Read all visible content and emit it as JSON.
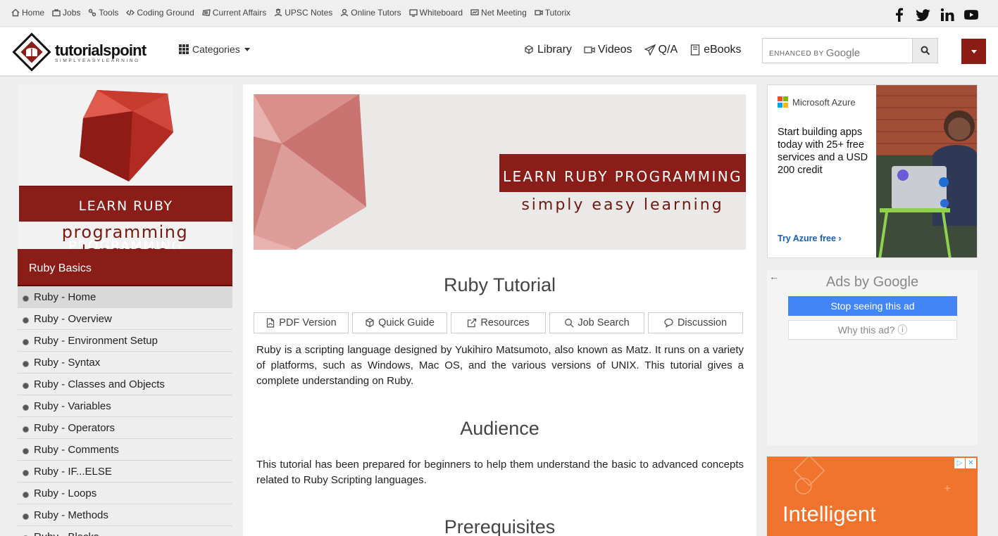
{
  "topbar": {
    "links": [
      {
        "label": "Home",
        "icon": "home-icon"
      },
      {
        "label": "Jobs",
        "icon": "briefcase-icon"
      },
      {
        "label": "Tools",
        "icon": "tools-icon"
      },
      {
        "label": "Coding Ground",
        "icon": "code-icon"
      },
      {
        "label": "Current Affairs",
        "icon": "newspaper-icon"
      },
      {
        "label": "UPSC Notes",
        "icon": "user-graduate-icon"
      },
      {
        "label": "Online Tutors",
        "icon": "user-icon"
      },
      {
        "label": "Whiteboard",
        "icon": "whiteboard-icon"
      },
      {
        "label": "Net Meeting",
        "icon": "meeting-icon"
      },
      {
        "label": "Tutorix",
        "icon": "video-icon"
      }
    ],
    "social": [
      "facebook-icon",
      "twitter-icon",
      "linkedin-icon",
      "youtube-icon"
    ]
  },
  "header": {
    "logo_text": "tutorialspoint",
    "logo_tagline": "SIMPLYEASYLEARNING",
    "categories_label": "Categories",
    "nav": [
      {
        "label": "Library",
        "icon": "library-icon"
      },
      {
        "label": "Videos",
        "icon": "video-icon"
      },
      {
        "label": "Q/A",
        "icon": "paper-plane-icon"
      },
      {
        "label": "eBooks",
        "icon": "book-icon"
      }
    ],
    "search_prefix": "ENHANCED BY",
    "search_brand": "Google"
  },
  "sidebar": {
    "banner_band": "LEARN RUBY PROGRAMMING",
    "banner_sub": "programming language",
    "heading": "Ruby Basics",
    "items": [
      "Ruby - Home",
      "Ruby - Overview",
      "Ruby - Environment Setup",
      "Ruby - Syntax",
      "Ruby - Classes and Objects",
      "Ruby - Variables",
      "Ruby - Operators",
      "Ruby - Comments",
      "Ruby - IF...ELSE",
      "Ruby - Loops",
      "Ruby - Methods",
      "Ruby - Blocks"
    ],
    "active_index": 0
  },
  "main": {
    "hero_band": "LEARN RUBY PROGRAMMING",
    "hero_sub": "simply easy learning",
    "title": "Ruby Tutorial",
    "tabs": [
      {
        "label": "PDF Version",
        "icon": "pdf-icon"
      },
      {
        "label": "Quick Guide",
        "icon": "cube-icon"
      },
      {
        "label": "Resources",
        "icon": "external-link-icon"
      },
      {
        "label": "Job Search",
        "icon": "search-icon"
      },
      {
        "label": "Discussion",
        "icon": "comments-icon"
      }
    ],
    "intro": "Ruby is a scripting language designed by Yukihiro Matsumoto, also known as Matz. It runs on a variety of platforms, such as Windows, Mac OS, and the various versions of UNIX. This tutorial gives a complete understanding on Ruby.",
    "audience_heading": "Audience",
    "audience_text": "This tutorial has been prepared for beginners to help them understand the basic to advanced concepts related to Ruby Scripting languages.",
    "prereq_heading": "Prerequisites"
  },
  "ads": {
    "azure": {
      "brand": "Microsoft Azure",
      "copy": "Start building apps today with 25+ free services and a USD 200 credit",
      "cta": "Try Azure free ›"
    },
    "google": {
      "back": "←",
      "ads_by": "Ads by Google",
      "stop": "Stop seeing this ad",
      "why": "Why this ad? ⓘ"
    },
    "orange": {
      "line1": "Intelligent",
      "adchoice": "▷",
      "close": "✕"
    }
  },
  "colors": {
    "brand_red": "#8b1d18",
    "google_blue": "#4285f4",
    "azure_link": "#1a5fb4",
    "ad_orange": "#f0732e"
  }
}
